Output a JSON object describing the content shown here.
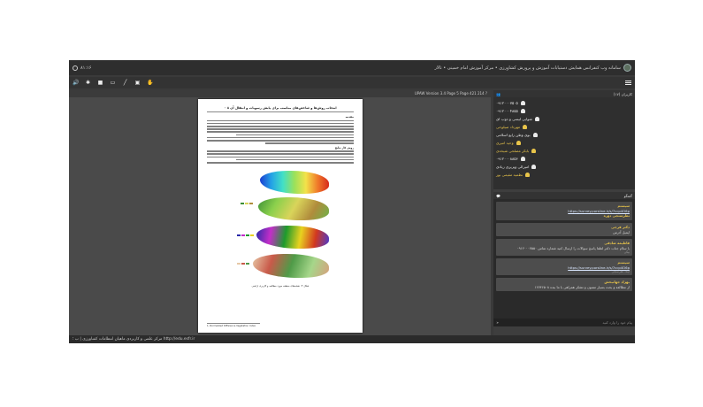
{
  "window": {
    "title": "سامانه وب کنفرانس همایش دستیابات آموزش و پرورش کشاورزی • مرکز آموزش امام خمینی • تالار",
    "time": "۸۱:۱۶"
  },
  "toolbar": {
    "icons": [
      "speaker-icon",
      "pointer-icon",
      "video-icon",
      "monitor-icon",
      "pen-icon",
      "whiteboard-icon",
      "hand-icon"
    ]
  },
  "document": {
    "bar_left": "",
    "bar_right": "UPAW Version 3.4 Page 5 Page 421 214 ?",
    "page_header": "انتخاب روش‌ها و شاخص‌های مناسب برای پایش رسوبات و انتقال آن ۸ ۰",
    "section1": "مقدمه",
    "section2": "روش کار نتایج",
    "caption": "شکل ۴: نقشه‌های منطقه مورد مطالعه و کاربری اراضی",
    "footnote": "1- Normalized Difference Vegetation Index"
  },
  "status": {
    "text": "مرکز علمی و کاربردی ماهیان انتظامات کشاورزی | ب ؛ http://edu.esfr.ir"
  },
  "users": {
    "header": "کاربران (۱۷)",
    "items": [
      {
        "name": "۰۹۱۲۰۰۰۷۵۰۵",
        "gold": false
      },
      {
        "name": "۰۹۱۲۰۰۰۴۸۵۵",
        "gold": false
      },
      {
        "name": "شوایی لیسی و ذوب ای",
        "gold": false
      },
      {
        "name": "مهرداد صیلوحی",
        "gold": true
      },
      {
        "name": "بوی وطن رابع اسلامی",
        "gold": false
      },
      {
        "name": "وحید امیری",
        "gold": true
      },
      {
        "name": "بابکر مصلحی شیخه‌ی",
        "gold": true
      },
      {
        "name": "۰۹۱۲۰۰۰۸۸۵۶",
        "gold": false
      },
      {
        "name": "امیرالی ویزیری زیادی",
        "gold": false
      },
      {
        "name": "نظمیه مقیمی بور",
        "gold": true
      }
    ]
  },
  "chat": {
    "header": "گفتگو",
    "pinned_sender": "سیستم",
    "pinned_link": "https://survey.porsline.ir/s/7ccp4O6p",
    "pinned_label": "نظرسنجی دوره",
    "messages": [
      {
        "sender": "دکتر فرجی",
        "text": "ایمیل آدرس",
        "time": ""
      },
      {
        "sender": "فاطیمه صادقی",
        "text": "با سلام جناب دکتر لطفا پاسخ سوالات را ارسال کنید شماره تماس ۰۹۱۲۰۰۰۷۵۵۰",
        "time": "بیگی"
      },
      {
        "sender": "سیستم",
        "text": "https://survey.porsline.ir/s/7ccp4O6p",
        "time": "لینک نظرسنجی"
      },
      {
        "sender": "بهزاد جهانبخش",
        "text": "از مطالعه و بحث بسیار ممنون و تشکر همراهی با ما بنده ۱۲۷۴۶۵۰۸",
        "time": ""
      }
    ],
    "input_placeholder": "پیام خود را وارد کنید"
  }
}
